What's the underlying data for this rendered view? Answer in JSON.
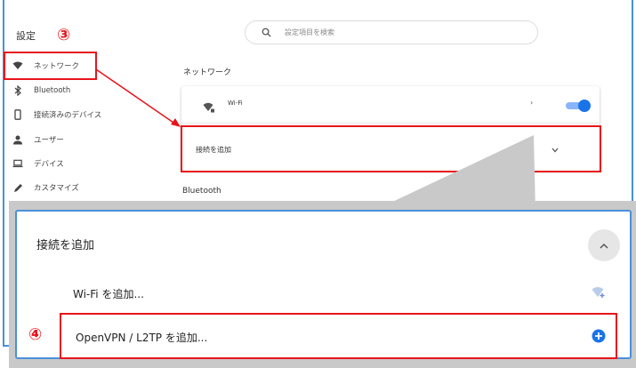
{
  "header": {
    "title": "設定",
    "search_placeholder": "設定項目を検索"
  },
  "sidebar": {
    "items": [
      {
        "label": "ネットワーク",
        "icon": "wifi-icon"
      },
      {
        "label": "Bluetooth",
        "icon": "bluetooth-icon"
      },
      {
        "label": "接続済みのデバイス",
        "icon": "phone-icon"
      },
      {
        "label": "ユーザー",
        "icon": "person-icon"
      },
      {
        "label": "デバイス",
        "icon": "laptop-icon"
      },
      {
        "label": "カスタマイズ",
        "icon": "pen-icon"
      }
    ]
  },
  "main": {
    "network_heading": "ネットワーク",
    "wifi_label": "Wi-Fi",
    "wifi_enabled": true,
    "add_connection_label": "接続を追加",
    "bluetooth_heading": "Bluetooth"
  },
  "zoom": {
    "title": "接続を追加",
    "add_wifi_label": "Wi-Fi を追加...",
    "add_vpn_label": "OpenVPN / L2TP を追加..."
  },
  "annotations": {
    "step3": "③",
    "step4": "④"
  },
  "colors": {
    "accent": "#1a73e8",
    "highlight": "#e8141b",
    "frame": "#4a90d9"
  }
}
